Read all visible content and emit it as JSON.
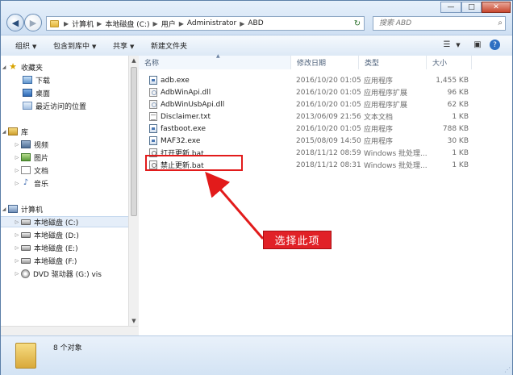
{
  "address": {
    "crumbs": [
      "计算机",
      "本地磁盘 (C:)",
      "用户",
      "Administrator",
      "ABD"
    ],
    "separator": "▶"
  },
  "search": {
    "placeholder": "搜索 ABD"
  },
  "window_controls": {
    "minimize": "—",
    "maximize": "□",
    "close": "✕"
  },
  "toolbar": {
    "organize": "组织",
    "include_in_library": "包含到库中",
    "share": "共享",
    "new_folder": "新建文件夹"
  },
  "sidebar": {
    "favorites": "收藏夹",
    "favorites_items": [
      "下载",
      "桌面",
      "最近访问的位置"
    ],
    "libraries": "库",
    "library_items": [
      "视频",
      "图片",
      "文档",
      "音乐"
    ],
    "computer": "计算机",
    "drives": [
      "本地磁盘 (C:)",
      "本地磁盘 (D:)",
      "本地磁盘 (E:)",
      "本地磁盘 (F:)",
      "DVD 驱动器 (G:) vis"
    ]
  },
  "columns": {
    "name": "名称",
    "modified": "修改日期",
    "type": "类型",
    "size": "大小"
  },
  "files": [
    {
      "name": "adb.exe",
      "modified": "2016/10/20 01:05",
      "type": "应用程序",
      "size": "1,455 KB",
      "icon": "exe"
    },
    {
      "name": "AdbWinApi.dll",
      "modified": "2016/10/20 01:05",
      "type": "应用程序扩展",
      "size": "96 KB",
      "icon": "dll"
    },
    {
      "name": "AdbWinUsbApi.dll",
      "modified": "2016/10/20 01:05",
      "type": "应用程序扩展",
      "size": "62 KB",
      "icon": "dll"
    },
    {
      "name": "Disclaimer.txt",
      "modified": "2013/06/09 21:56",
      "type": "文本文档",
      "size": "1 KB",
      "icon": "txt"
    },
    {
      "name": "fastboot.exe",
      "modified": "2016/10/20 01:05",
      "type": "应用程序",
      "size": "788 KB",
      "icon": "exe"
    },
    {
      "name": "MAF32.exe",
      "modified": "2015/08/09 14:50",
      "type": "应用程序",
      "size": "30 KB",
      "icon": "exe"
    },
    {
      "name": "打开更新.bat",
      "modified": "2018/11/12 08:59",
      "type": "Windows 批处理...",
      "size": "1 KB",
      "icon": "bat"
    },
    {
      "name": "禁止更新.bat",
      "modified": "2018/11/12 08:31",
      "type": "Windows 批处理...",
      "size": "1 KB",
      "icon": "bat"
    }
  ],
  "annotation": {
    "callout": "选择此项",
    "color": "#e21b1b"
  },
  "status": {
    "item_count": "8 个对象"
  }
}
